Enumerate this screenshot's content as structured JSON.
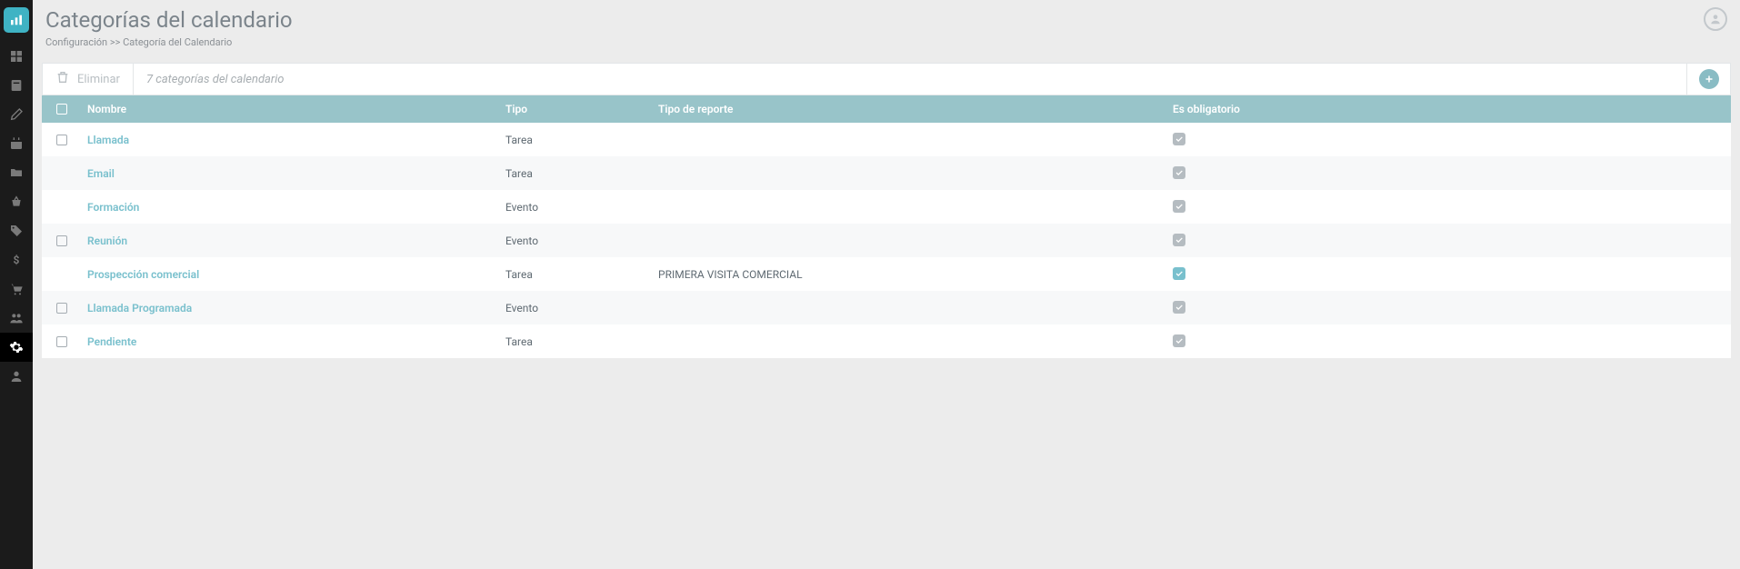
{
  "header": {
    "title": "Categorías del calendario",
    "breadcrumb": "Configuración >> Categoría del Calendario"
  },
  "toolbar": {
    "delete_label": "Eliminar",
    "count_text": "7 categorías del calendario"
  },
  "table": {
    "columns": {
      "name": "Nombre",
      "type": "Tipo",
      "report_type": "Tipo de reporte",
      "mandatory": "Es obligatorio"
    },
    "rows": [
      {
        "name": "Llamada",
        "type": "Tarea",
        "report_type": "",
        "mandatory": true,
        "highlight": false,
        "show_row_checkbox": true
      },
      {
        "name": "Email",
        "type": "Tarea",
        "report_type": "",
        "mandatory": true,
        "highlight": false,
        "show_row_checkbox": false
      },
      {
        "name": "Formación",
        "type": "Evento",
        "report_type": "",
        "mandatory": true,
        "highlight": false,
        "show_row_checkbox": false
      },
      {
        "name": "Reunión",
        "type": "Evento",
        "report_type": "",
        "mandatory": true,
        "highlight": false,
        "show_row_checkbox": true
      },
      {
        "name": "Prospección comercial",
        "type": "Tarea",
        "report_type": "PRIMERA VISITA COMERCIAL",
        "mandatory": true,
        "highlight": true,
        "show_row_checkbox": false
      },
      {
        "name": "Llamada Programada",
        "type": "Evento",
        "report_type": "",
        "mandatory": true,
        "highlight": false,
        "show_row_checkbox": true
      },
      {
        "name": "Pendiente",
        "type": "Tarea",
        "report_type": "",
        "mandatory": true,
        "highlight": false,
        "show_row_checkbox": true
      }
    ]
  },
  "sidebar": {
    "items": [
      {
        "name": "dashboard"
      },
      {
        "name": "activities"
      },
      {
        "name": "notes"
      },
      {
        "name": "calendar"
      },
      {
        "name": "folder"
      },
      {
        "name": "basket"
      },
      {
        "name": "tag"
      },
      {
        "name": "money"
      },
      {
        "name": "cart"
      },
      {
        "name": "users"
      },
      {
        "name": "settings",
        "active": true
      },
      {
        "name": "profile"
      }
    ]
  }
}
